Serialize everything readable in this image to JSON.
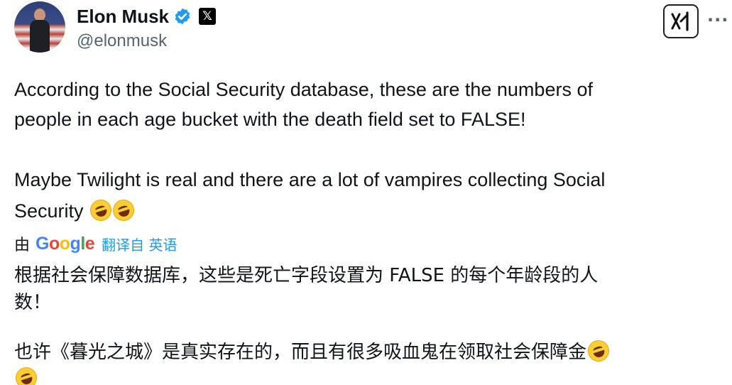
{
  "author": {
    "display_name": "Elon Musk",
    "handle": "@elonmusk",
    "verified_icon": "verified-badge-icon",
    "affiliation_icon": "x-logo-icon",
    "affiliation_glyph": "𝕏"
  },
  "actions": {
    "grok_icon": "grok-icon",
    "more_icon": "more-icon",
    "more_glyph": "···"
  },
  "post": {
    "line1": "According to the Social Security database, these are the numbers of",
    "line2": "people in each age bucket with the death field set to FALSE!",
    "line3": "Maybe Twilight is real and there are a lot of vampires collecting Social",
    "line4": "Security",
    "emoji": "rolling-on-the-floor-laughing"
  },
  "translation": {
    "by_label": "由",
    "google_letters": [
      "G",
      "o",
      "o",
      "g",
      "l",
      "e"
    ],
    "action_label": "翻译自 英语",
    "line1": "根据社会保障数据库，这些是死亡字段设置为 FALSE 的每个年龄段的人",
    "line2": "数！",
    "line3": "也许《暮光之城》是真实存在的，而且有很多吸血鬼在领取社会保障金"
  },
  "colors": {
    "link": "#1d9bf0",
    "verified": "#1d9bf0",
    "text": "#0f1419",
    "secondary": "#536471"
  }
}
